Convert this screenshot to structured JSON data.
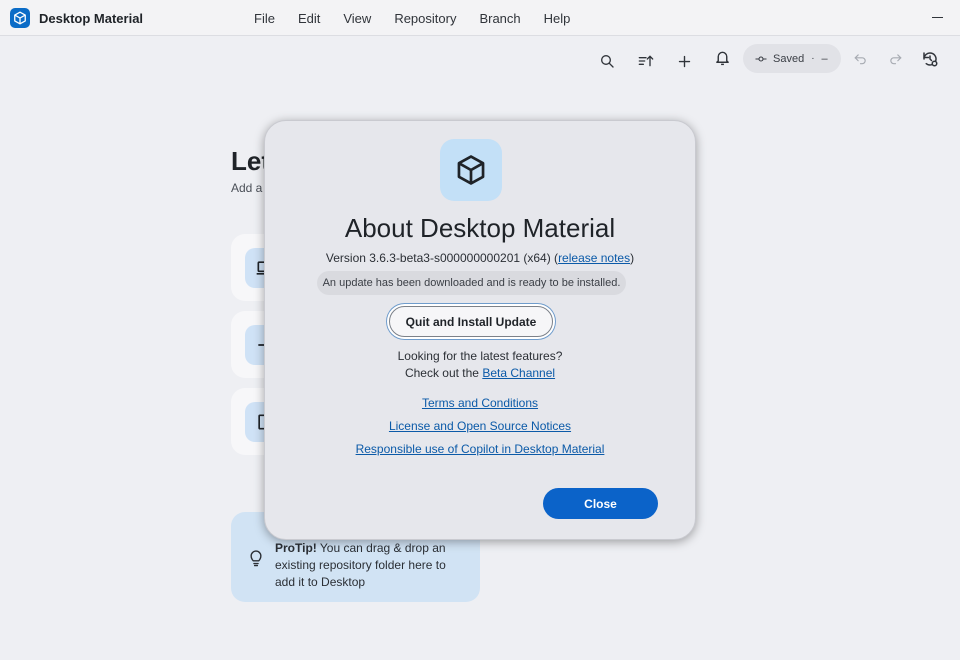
{
  "app": {
    "name": "Desktop Material"
  },
  "menu": {
    "file": "File",
    "edit": "Edit",
    "view": "View",
    "repository": "Repository",
    "branch": "Branch",
    "help": "Help"
  },
  "toolbar": {
    "saved_label": "Saved",
    "saved_dot": "·",
    "saved_dash": "–"
  },
  "background": {
    "title": "Let",
    "subtitle": "Add a",
    "protip": {
      "bold": "ProTip!",
      "text": " You can drag & drop an existing repository folder here to add it to Desktop"
    }
  },
  "dialog": {
    "title": "About Desktop Material",
    "version_prefix": "Version 3.6.3-beta3-s000000000201 (x64) (",
    "release_notes": "release notes",
    "version_suffix": ")",
    "update_message": "An update has been downloaded and is ready to be installed.",
    "quit_button": "Quit and Install Update",
    "looking": "Looking for the latest features?",
    "checkout_prefix": "Check out the ",
    "beta_channel": "Beta Channel",
    "terms": "Terms and Conditions",
    "license": "License and Open Source Notices",
    "copilot": "Responsible use of Copilot in Desktop Material",
    "close_button": "Close"
  },
  "colors": {
    "accent": "#0b63c9",
    "link": "#0b5aa8",
    "logo_bg": "#c3e0f7",
    "protip_bg": "#d1e3f4"
  },
  "icons": {
    "app_logo": "cube-icon",
    "search": "search-icon",
    "sort": "sort-icon",
    "add": "plus-icon",
    "notifications": "bell-icon",
    "commit": "commit-icon",
    "undo": "undo-icon",
    "redo": "redo-icon",
    "history": "history-settings-icon",
    "tip": "lightbulb-icon"
  }
}
